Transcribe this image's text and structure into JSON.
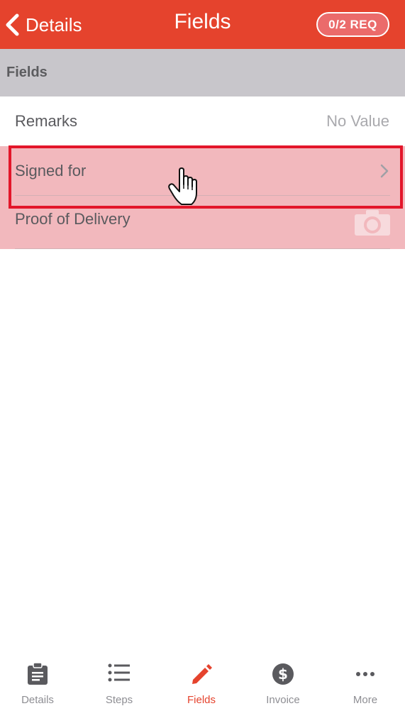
{
  "colors": {
    "accent": "#e5432d",
    "highlight": "#e3162a",
    "row_highlight": "#f2b8bd",
    "section_bg": "#c8c6cb"
  },
  "navbar": {
    "back_label": "Details",
    "title": "Fields",
    "badge": "0/2 REQ"
  },
  "section": {
    "title": "Fields"
  },
  "rows": [
    {
      "label": "Remarks",
      "value": "No Value",
      "icon": "none"
    },
    {
      "label": "Signed for",
      "icon": "chevron-right-icon"
    },
    {
      "label": "Proof of Delivery",
      "icon": "camera-icon"
    }
  ],
  "tabs": [
    {
      "label": "Details",
      "icon": "clipboard-icon",
      "active": false
    },
    {
      "label": "Steps",
      "icon": "list-icon",
      "active": false
    },
    {
      "label": "Fields",
      "icon": "pencil-icon",
      "active": true
    },
    {
      "label": "Invoice",
      "icon": "dollar-icon",
      "active": false
    },
    {
      "label": "More",
      "icon": "ellipsis-icon",
      "active": false
    }
  ]
}
